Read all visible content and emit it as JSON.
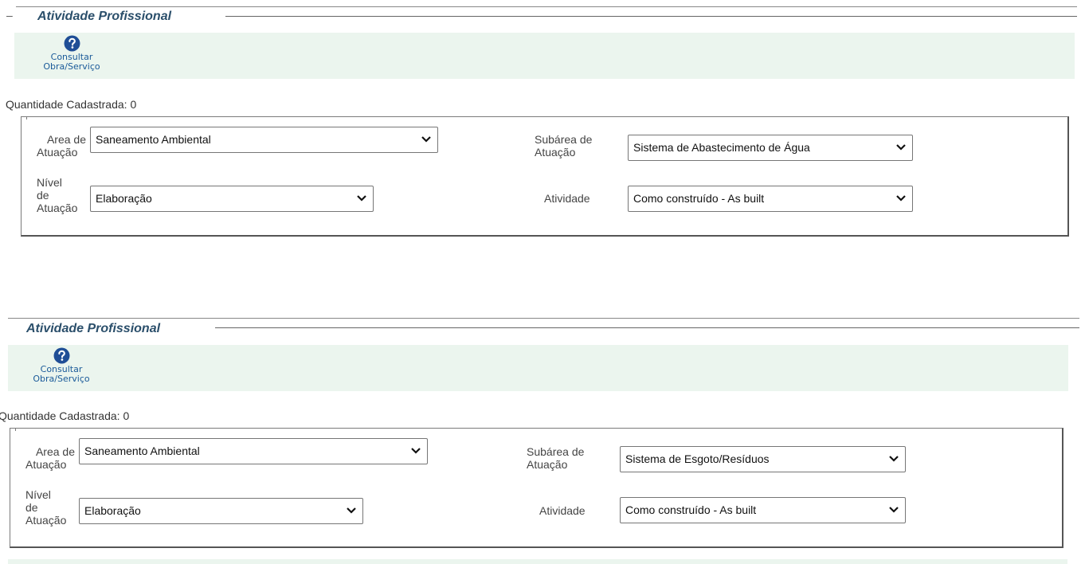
{
  "sections": [
    {
      "title": "Atividade Profissional",
      "consult_label_1": "Consultar",
      "consult_label_2": "Obra/Serviço",
      "quantity_text": "Quantidade Cadastrada: 0",
      "area_label_1": "Area de",
      "area_label_2": "Atuação",
      "area_value": "Saneamento Ambiental",
      "subarea_label_1": "Subárea de",
      "subarea_label_2": "Atuação",
      "subarea_value": "Sistema de Abastecimento de Água",
      "nivel_label_1": "Nível",
      "nivel_label_2": "de",
      "nivel_label_3": "Atuação",
      "nivel_value": "Elaboração",
      "atividade_label": "Atividade",
      "atividade_value": "Como construído - As built"
    },
    {
      "title": "Atividade Profissional",
      "consult_label_1": "Consultar",
      "consult_label_2": "Obra/Serviço",
      "quantity_text": "Quantidade Cadastrada: 0",
      "area_label_1": "Area de",
      "area_label_2": "Atuação",
      "area_value": "Saneamento Ambiental",
      "subarea_label_1": "Subárea de",
      "subarea_label_2": "Atuação",
      "subarea_value": "Sistema de Esgoto/Resíduos",
      "nivel_label_1": "Nível",
      "nivel_label_2": "de",
      "nivel_label_3": "Atuação",
      "nivel_value": "Elaboração",
      "atividade_label": "Atividade",
      "atividade_value": "Como construído - As built"
    }
  ],
  "collapse_symbol": "–",
  "icons": {
    "help": "help-circle-icon",
    "chevron": "chevron-down-icon"
  },
  "colors": {
    "title": "#2b4f6b",
    "toolbar_bg": "#ebf5ee",
    "link": "#1a5a99",
    "icon": "#1f4e96"
  }
}
